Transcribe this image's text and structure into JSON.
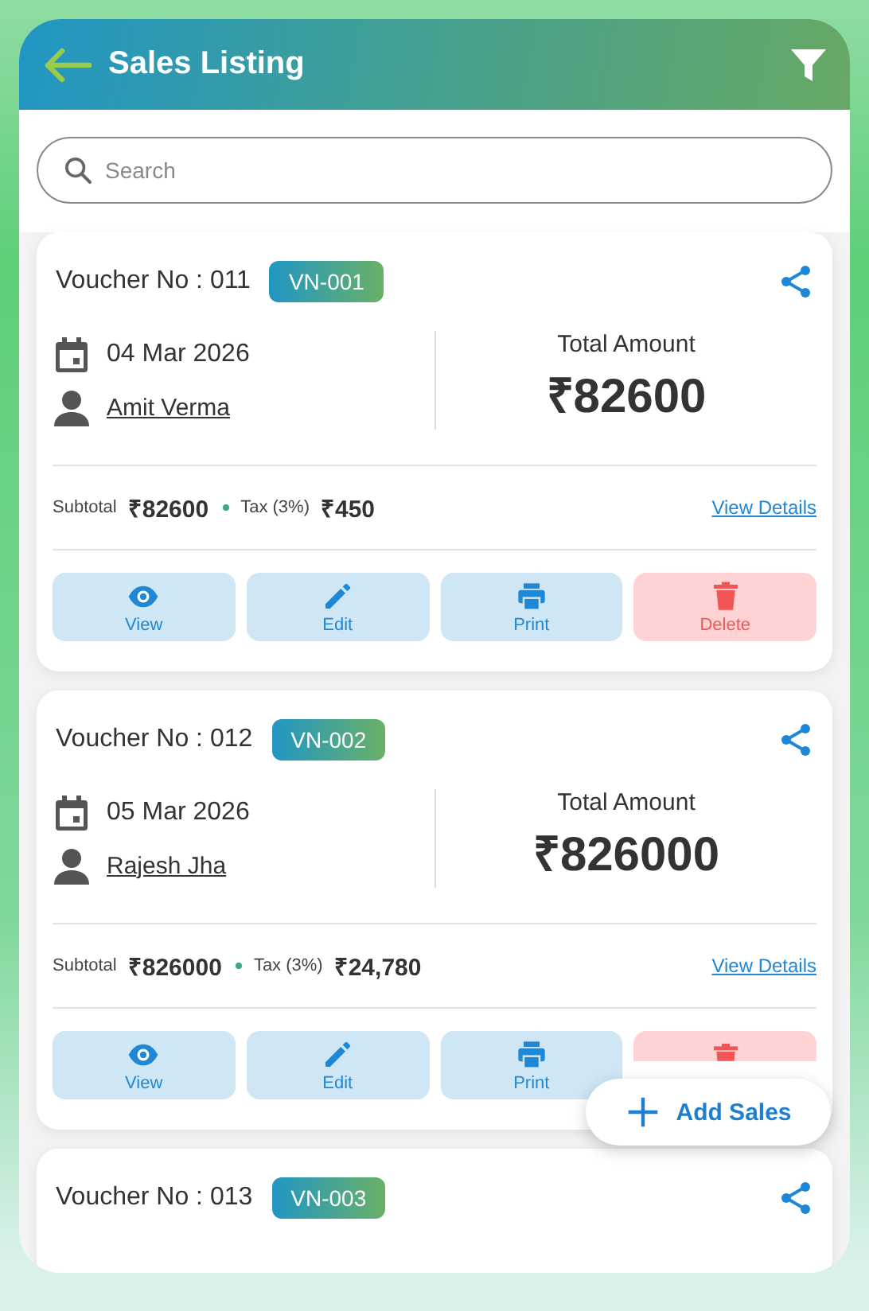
{
  "header": {
    "title": "Sales Listing"
  },
  "search": {
    "placeholder": "Search"
  },
  "vouchers": [
    {
      "voucher_label": "Voucher No : 011",
      "code": "VN-001",
      "date": "04 Mar 2026",
      "customer": "Amit Verma",
      "total_label": "Total Amount",
      "total": "₹82600",
      "subtotal_label": "Subtotal",
      "subtotal": "₹82600",
      "tax_label": "Tax (3%)",
      "tax": "₹450",
      "details_link": "View Details",
      "actions": [
        {
          "kind": "view",
          "label": "View"
        },
        {
          "kind": "edit",
          "label": "Edit"
        },
        {
          "kind": "print",
          "label": "Print"
        },
        {
          "kind": "delete",
          "label": "Delete"
        }
      ]
    },
    {
      "voucher_label": "Voucher No : 012",
      "code": "VN-002",
      "date": "05 Mar 2026",
      "customer": "Rajesh Jha",
      "total_label": "Total Amount",
      "total": "₹826000",
      "subtotal_label": "Subtotal",
      "subtotal": "₹826000",
      "tax_label": "Tax (3%)",
      "tax": "₹24,780",
      "details_link": "View Details",
      "actions": [
        {
          "kind": "view",
          "label": "View"
        },
        {
          "kind": "edit",
          "label": "Edit"
        },
        {
          "kind": "print",
          "label": "Print"
        },
        {
          "kind": "delete"
        }
      ]
    },
    {
      "voucher_label": "Voucher No : 013",
      "code": "VN-003"
    }
  ],
  "fab": {
    "label": "Add Sales"
  }
}
